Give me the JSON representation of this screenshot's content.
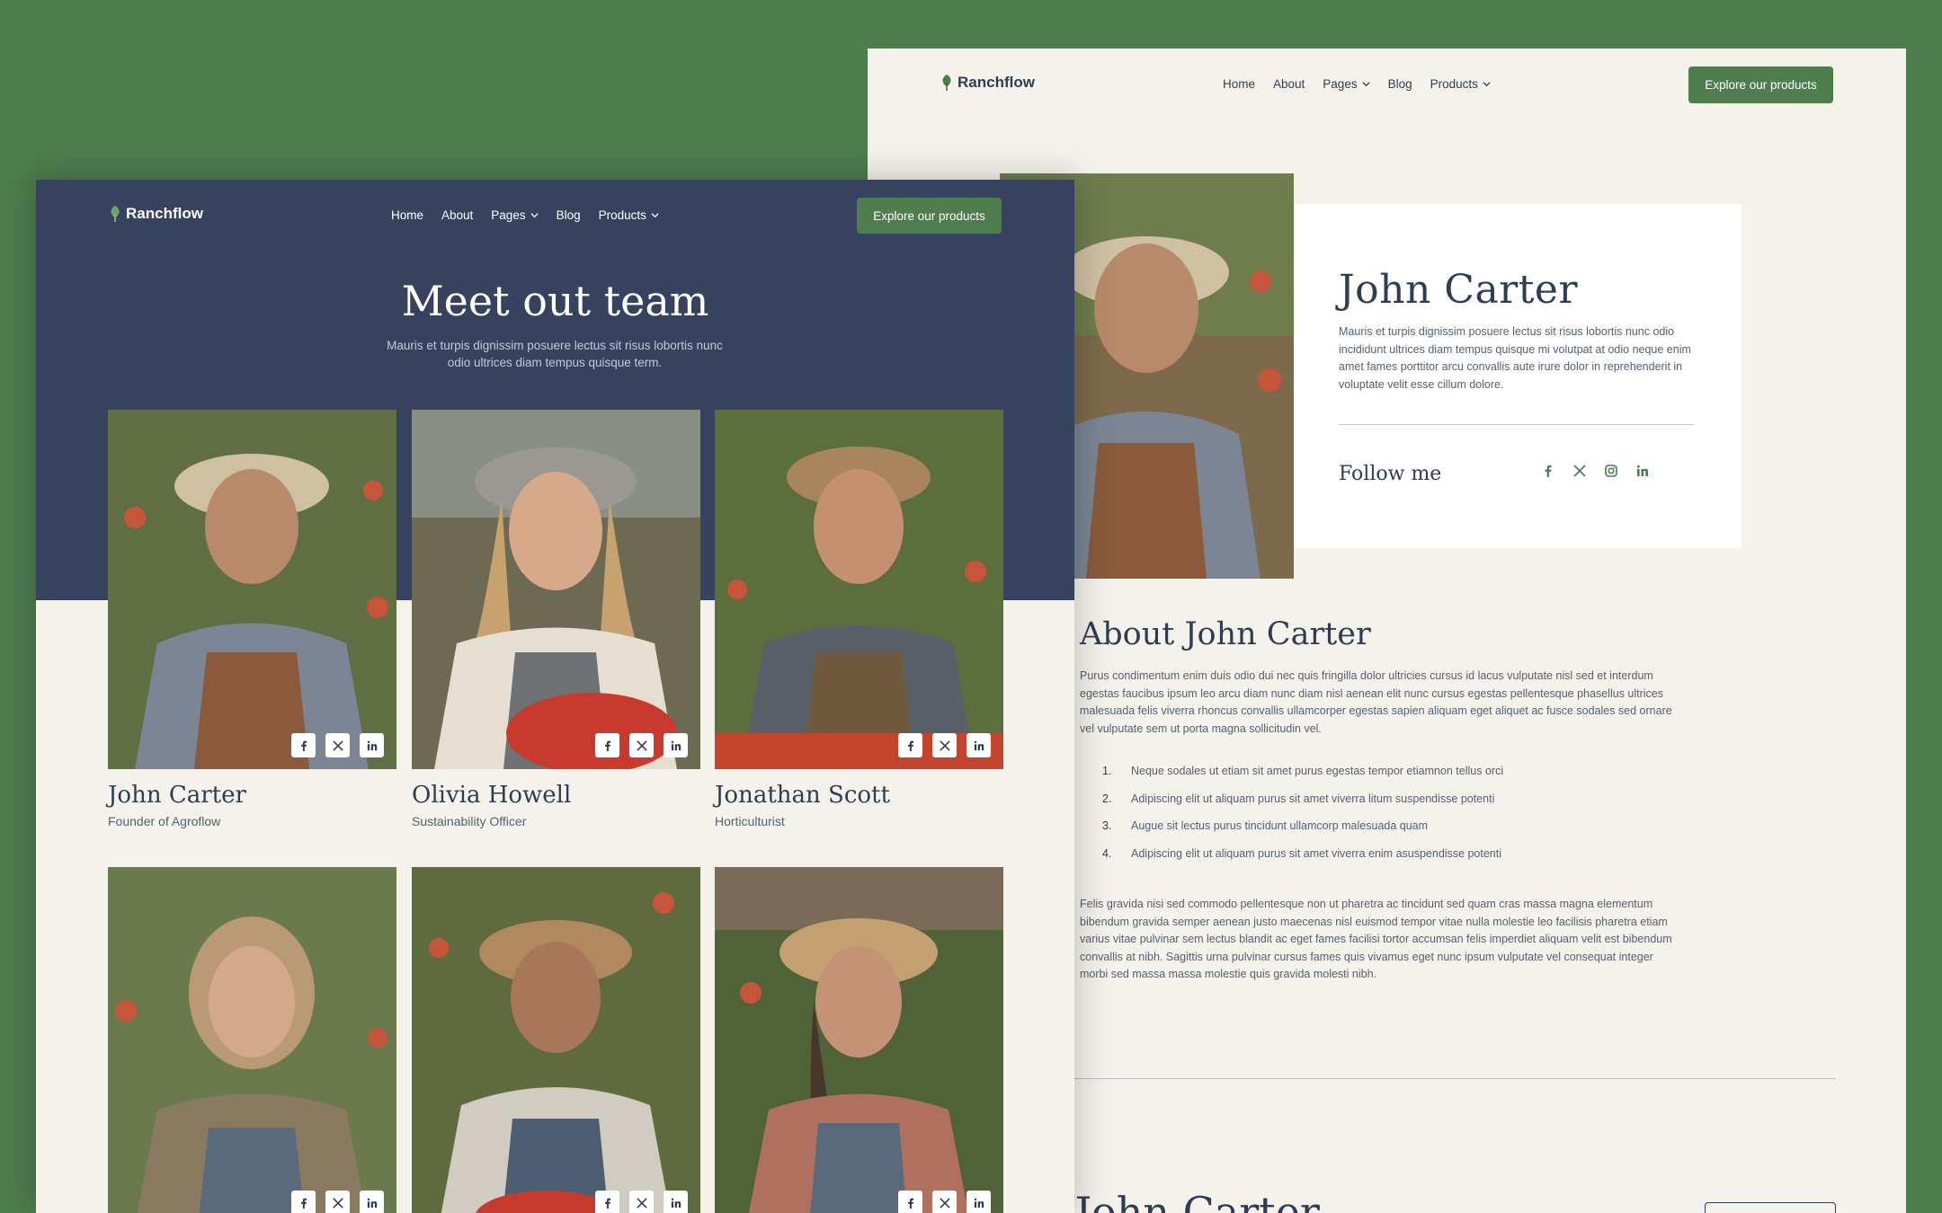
{
  "brand": {
    "name": "Ranchflow",
    "accent": "#4e7d4e",
    "navy": "#36425e"
  },
  "nav": {
    "items": [
      "Home",
      "About",
      "Pages",
      "Blog",
      "Products"
    ],
    "cta": "Explore our products"
  },
  "team_page": {
    "title": "Meet out team",
    "subtitle": "Mauris et turpis dignissim posuere lectus sit risus lobortis nunc odio ultrices diam tempus quisque term.",
    "members": [
      {
        "name": "John Carter",
        "role": "Founder of Agroflow"
      },
      {
        "name": "Olivia Howell",
        "role": "Sustainability Officer"
      },
      {
        "name": "Jonathan Scott",
        "role": "Horticulturist"
      },
      {
        "name": "",
        "role": ""
      },
      {
        "name": "",
        "role": ""
      },
      {
        "name": "",
        "role": ""
      }
    ],
    "member_social_icons": [
      "facebook-icon",
      "x-icon",
      "linkedin-icon"
    ]
  },
  "profile_page": {
    "name": "John Carter",
    "bio": "Mauris et turpis dignissim posuere lectus sit risus lobortis nunc odio incididunt ultrices diam tempus quisque mi volutpat at odio neque enim amet fames porttitor arcu convallis aute irure dolor in reprehenderit in voluptate  velit esse cillum dolore.",
    "follow_label": "Follow me",
    "follow_icons": [
      "facebook-icon",
      "x-icon",
      "instagram-icon",
      "linkedin-icon"
    ],
    "about_title": "About John Carter",
    "about_paragraph_1": "Purus condimentum enim duis odio dui nec quis fringilla dolor ultricies cursus id lacus vulputate nisl sed et interdum egestas faucibus ipsum leo arcu diam nunc diam nisl aenean elit nunc cursus egestas pellentesque phasellus ultrices malesuada felis viverra rhoncus convallis ullamcorper egestas sapien aliquam eget aliquet ac fusce sodales sed ornare vel vulputate sem ut porta magna sollicitudin vel.",
    "about_list": [
      {
        "num": "1.",
        "text": "Neque sodales ut etiam sit amet purus  egestas tempor etiamnon tellus orci"
      },
      {
        "num": "2.",
        "text": "Adipiscing elit ut aliquam purus sit amet viverra litum suspendisse potenti"
      },
      {
        "num": "3.",
        "text": "Augue sit lectus purus tincidunt ullamcorp malesuada quam"
      },
      {
        "num": "4.",
        "text": "Adipiscing elit ut aliquam purus sit amet viverra enim asuspendisse potenti"
      }
    ],
    "about_paragraph_2": "Felis gravida nisi sed commodo pellentesque non ut pharetra ac tincidunt sed quam cras massa magna elementum bibendum gravida semper aenean justo maecenas nisl euismod tempor vitae nulla molestie leo facilisis pharetra etiam varius vitae pulvinar sem lectus blandit ac eget fames facilisi tortor accumsan felis imperdiet aliquam velit est bibendum convallis at nibh. Sagittis urna pulvinar cursus fames quis vivamus eget nunc ipsum vulputate vel consequat integer morbi sed massa massa molestie quis gravida molesti nibh.",
    "bottom_heading": "y John Carter"
  }
}
